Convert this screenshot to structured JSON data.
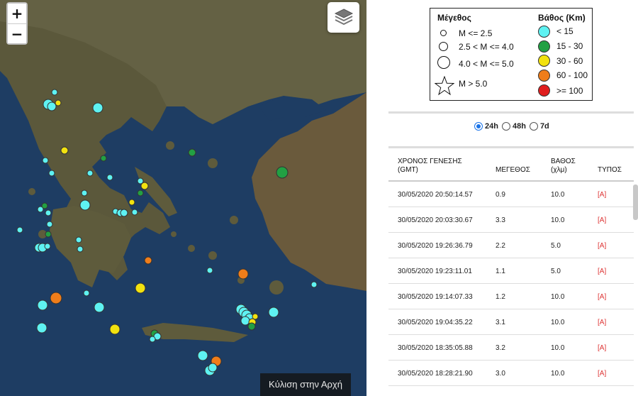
{
  "map": {
    "zoom_in_label": "+",
    "zoom_out_label": "−",
    "layers_icon": "layers-icon",
    "scroll_top_label": "Κύλιση στην Αρχή",
    "colors": {
      "sea": "#1f3f66",
      "land": "#5c5a3c"
    },
    "markers": [
      {
        "depth": "<15",
        "size": "medium"
      },
      {
        "depth": "<15",
        "size": "medium"
      },
      {
        "depth": "15-30",
        "size": "medium"
      },
      {
        "depth": "30-60",
        "size": "medium"
      },
      {
        "depth": "60-100",
        "size": "medium"
      }
    ]
  },
  "legend": {
    "magnitude_title": "Μέγεθος",
    "magnitude_items": [
      "M <= 2.5",
      "2.5 < M <= 4.0",
      "4.0 < M <= 5.0",
      "M > 5.0"
    ],
    "depth_title": "Βάθος (Km)",
    "depth_items": [
      {
        "label": "< 15",
        "color": "#5ef2f2"
      },
      {
        "label": "15 - 30",
        "color": "#22a043"
      },
      {
        "label": "30 - 60",
        "color": "#f2e20f"
      },
      {
        "label": "60 - 100",
        "color": "#ef7d1a"
      },
      {
        "label": ">= 100",
        "color": "#e01e1e"
      }
    ]
  },
  "filter": {
    "options": [
      "24h",
      "48h",
      "7d"
    ],
    "selected": "24h"
  },
  "table": {
    "headers": {
      "time_line1": "ΧΡΟΝΟΣ ΓΕΝΕΣΗΣ",
      "time_line2": "(GMT)",
      "magnitude": "ΜΕΓΕΘΟΣ",
      "depth_line1": "ΒΑΘΟΣ",
      "depth_line2": "(χλμ)",
      "type": "ΤΥΠΟΣ"
    },
    "rows": [
      {
        "time": "30/05/2020 20:50:14.57",
        "mag": "0.9",
        "depth": "10.0",
        "type": "[A]"
      },
      {
        "time": "30/05/2020 20:03:30.67",
        "mag": "3.3",
        "depth": "10.0",
        "type": "[A]"
      },
      {
        "time": "30/05/2020 19:26:36.79",
        "mag": "2.2",
        "depth": "5.0",
        "type": "[A]"
      },
      {
        "time": "30/05/2020 19:23:11.01",
        "mag": "1.1",
        "depth": "5.0",
        "type": "[A]"
      },
      {
        "time": "30/05/2020 19:14:07.33",
        "mag": "1.2",
        "depth": "10.0",
        "type": "[A]"
      },
      {
        "time": "30/05/2020 19:04:35.22",
        "mag": "3.1",
        "depth": "10.0",
        "type": "[A]"
      },
      {
        "time": "30/05/2020 18:35:05.88",
        "mag": "3.2",
        "depth": "10.0",
        "type": "[A]"
      },
      {
        "time": "30/05/2020 18:28:21.90",
        "mag": "3.0",
        "depth": "10.0",
        "type": "[A]"
      }
    ]
  }
}
